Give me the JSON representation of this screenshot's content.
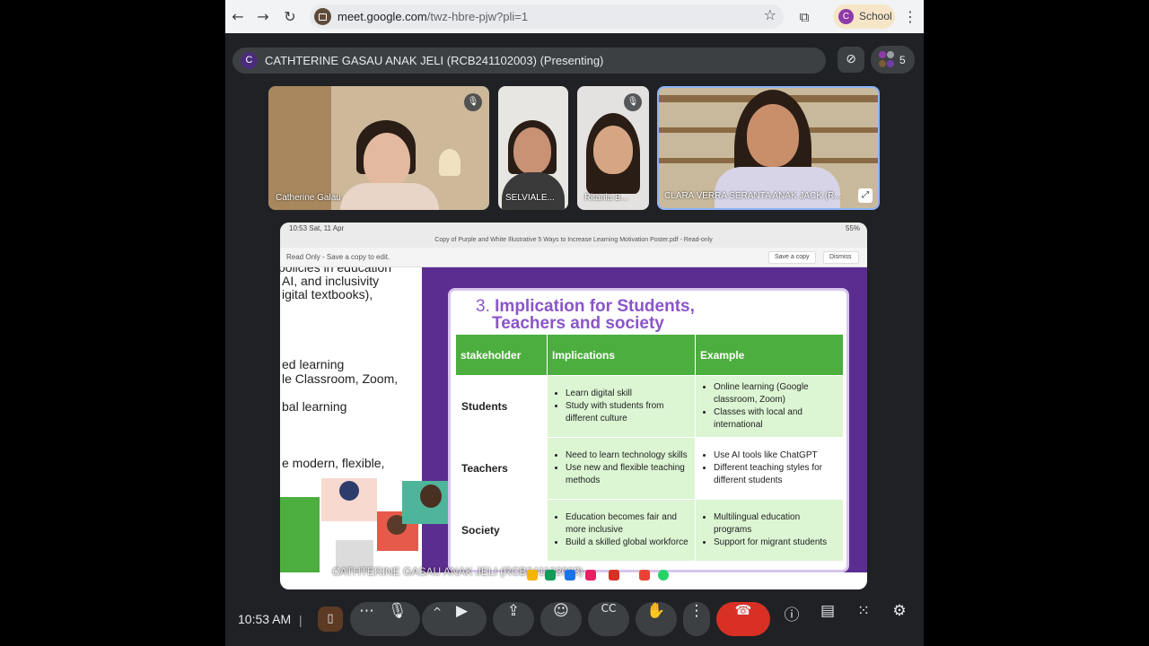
{
  "browser": {
    "url_host": "meet.google.com",
    "url_path": "/twz-hbre-pjw?pli=1",
    "profile_initial": "C",
    "profile_label": "School"
  },
  "presenter": {
    "avatar_initial": "C",
    "text": "CATHTERINE GASAU ANAK JELI (RCB241102003) (Presenting)"
  },
  "participants": {
    "count": "5",
    "avatar_initials": [
      "C",
      "C"
    ],
    "tiles": [
      {
        "name": "Catherine Galau",
        "muted": true
      },
      {
        "name": "SELVIALE...",
        "muted": false
      },
      {
        "name": "Ritania B...",
        "muted": true
      },
      {
        "name": "CLARA VERRA SERANTA ANAK JACK (R...",
        "muted": false
      }
    ]
  },
  "share": {
    "status_time": "10:53  Sat, 11 Apr",
    "status_right": "55%",
    "doc_title": "Copy of Purple and White Illustrative 5 Ways to Increase Learning Motivation Poster.pdf - Read-only",
    "readonly_text": "Read Only - Save a copy to edit.",
    "save_copy_label": "Save a copy",
    "dismiss_label": "Dismiss",
    "left_lines": [
      "policies in education",
      "AI, and inclusivity",
      "igital textbooks),",
      "ed learning",
      "le Classroom, Zoom,",
      "bal learning",
      "e modern, flexible,"
    ],
    "card_number": "3.",
    "card_title_1": "Implication for Students,",
    "card_title_2": "Teachers and society",
    "table": {
      "headers": [
        "stakeholder",
        "Implications",
        "Example"
      ],
      "rows": [
        {
          "stakeholder": "Students",
          "implications": [
            "Learn digital skill",
            "Study with students from different culture"
          ],
          "examples": [
            "Online learning (Google classroom, Zoom)",
            "Classes with local and international"
          ]
        },
        {
          "stakeholder": "Teachers",
          "implications": [
            "Need to learn technology skills",
            "Use new and flexible teaching methods"
          ],
          "examples": [
            "Use AI tools like ChatGPT",
            "Different teaching styles for different students"
          ]
        },
        {
          "stakeholder": "Society",
          "implications": [
            "Education becomes fair and more inclusive",
            "Build a skilled global workforce"
          ],
          "examples": [
            "Multilingual education programs",
            "Support for migrant students"
          ]
        }
      ]
    },
    "taskbar_text": "CATHTERINE GASAU ANAK JELI (RCB241102003)"
  },
  "controls": {
    "clock": "10:53 AM",
    "separator": "|"
  },
  "colors": {
    "end_call": "#d93025",
    "table_header": "#4cae3e",
    "table_cell": "#dcf5d3",
    "slide_purple": "#5c2d91",
    "title_purple": "#8a55c8"
  }
}
